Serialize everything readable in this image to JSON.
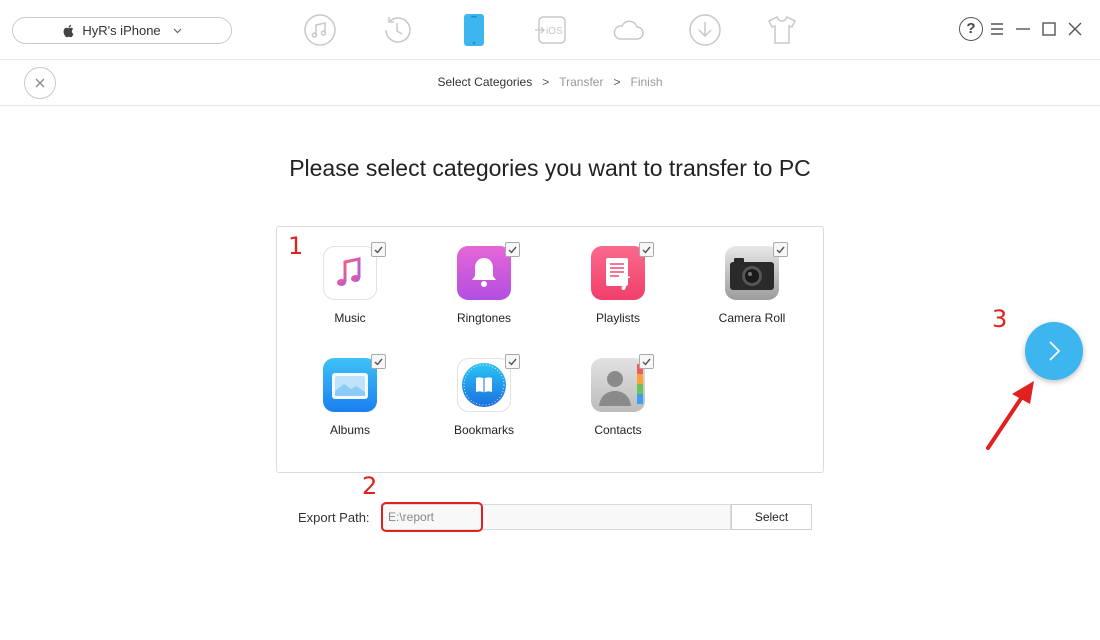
{
  "device": {
    "name": "HyR's iPhone"
  },
  "nav": {
    "icons": [
      "music-icon",
      "history-icon",
      "device-icon",
      "ios-mover-icon",
      "icloud-icon",
      "download-icon",
      "tshirt-icon"
    ],
    "active": "device-icon"
  },
  "window": {
    "help": "?"
  },
  "steps": {
    "step1": "Select Categories",
    "step2": "Transfer",
    "step3": "Finish",
    "separator": ">"
  },
  "heading": "Please select categories you want to transfer to PC",
  "categories": [
    {
      "label": "Music",
      "icon": "music-app-icon",
      "checked": true
    },
    {
      "label": "Ringtones",
      "icon": "ringtones-icon",
      "checked": true
    },
    {
      "label": "Playlists",
      "icon": "playlists-icon",
      "checked": true
    },
    {
      "label": "Camera Roll",
      "icon": "camera-icon",
      "checked": true
    },
    {
      "label": "Albums",
      "icon": "albums-icon",
      "checked": true
    },
    {
      "label": "Bookmarks",
      "icon": "safari-icon",
      "checked": true
    },
    {
      "label": "Contacts",
      "icon": "contacts-icon",
      "checked": true
    }
  ],
  "export": {
    "label": "Export Path:",
    "value": "E:\\report",
    "select_label": "Select"
  },
  "annotations": {
    "one": "1",
    "two": "2",
    "three": "3"
  },
  "colors": {
    "accent": "#3db5ee",
    "annotation": "#e0211f",
    "active_nav": "#3db5ee"
  }
}
